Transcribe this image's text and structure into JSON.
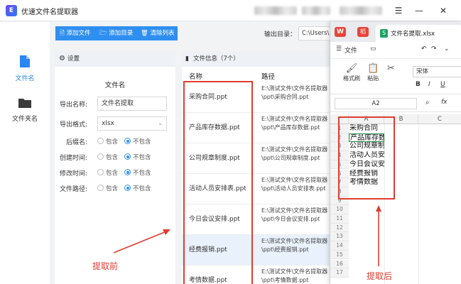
{
  "app": {
    "title": "优速文件名提取器",
    "logo_text": "E",
    "window_controls": [
      "☰",
      "—",
      "✕"
    ]
  },
  "sidebar": {
    "items": [
      {
        "label": "文件名",
        "icon": "file-icon",
        "active": true
      },
      {
        "label": "文件夹名",
        "icon": "folder-icon",
        "active": false
      }
    ]
  },
  "toolbar": {
    "add_file": "添加文件",
    "add_dir": "添加目录",
    "clear_list": "清除列表",
    "output_label": "输出目录：",
    "output_value": "C:\\Users\\"
  },
  "settings": {
    "header": "设置",
    "section_title": "文件名",
    "export_name_label": "导出名称:",
    "export_name_value": "文件名提取",
    "export_format_label": "导出格式:",
    "export_format_value": "xlsx",
    "options": [
      {
        "label": "后缀名:",
        "opt1": "包含",
        "opt2": "不包含",
        "selected": 2
      },
      {
        "label": "创建时间:",
        "opt1": "包含",
        "opt2": "不包含",
        "selected": 2
      },
      {
        "label": "修改时间:",
        "opt1": "包含",
        "opt2": "不包含",
        "selected": 2
      },
      {
        "label": "文件路径:",
        "opt1": "包含",
        "opt2": "不包含",
        "selected": 2
      }
    ]
  },
  "file_info": {
    "header": "文件信息（7个）",
    "col_name": "名称",
    "col_path": "路径",
    "rows": [
      {
        "name": "采购合同.ppt",
        "path": "E:\\测试文件\\文件名提取器\\ppt\\采购合同.ppt"
      },
      {
        "name": "产品库存数据.ppt",
        "path": "E:\\测试文件\\文件名提取器\\ppt\\产品库存数据.ppt"
      },
      {
        "name": "公司规章制度.ppt",
        "path": "E:\\测试文件\\文件名提取器\\ppt\\公司规章制度.ppt"
      },
      {
        "name": "活动人员安排表.ppt",
        "path": "E:\\测试文件\\文件名提取器\\ppt\\活动人员安排表.ppt"
      },
      {
        "name": "今日会议安排.ppt",
        "path": "E:\\测试文件\\文件名提取器\\ppt\\今日会议安排.ppt"
      },
      {
        "name": "经费报销.ppt",
        "path": "E:\\测试文件\\文件名提取器\\ppt\\经费报销.ppt"
      },
      {
        "name": "考情数据.ppt",
        "path": "E:\\测试文件\\文件名提取器\\ppt\\考情数据.ppt"
      }
    ]
  },
  "wps": {
    "logo_text": "W",
    "logo2_text": "稻",
    "tab_title": "文件名提取.xlsx",
    "sheet_icon_text": "S",
    "menu_file": "文件",
    "ribbon": {
      "format_painter": "格式刷",
      "paste": "粘贴",
      "font_name": "宋体",
      "bold": "B",
      "italic": "I",
      "underline": "U"
    },
    "name_box": "A2",
    "fx": "fx",
    "columns": [
      "A",
      "B",
      "C"
    ],
    "row_numbers": [
      "1",
      "2",
      "3",
      "4",
      "5",
      "6",
      "7",
      "8",
      "9",
      "10",
      "11",
      "12",
      "13",
      "14",
      "15",
      "16",
      "17"
    ],
    "cells": [
      "采购合同",
      "产品库存数据",
      "公司规章制度",
      "活动人员安排表",
      "今日会议安排",
      "经费报销",
      "考情数据"
    ]
  },
  "annotations": {
    "before": "提取前",
    "after": "提取后",
    "color": "#e03c31"
  }
}
